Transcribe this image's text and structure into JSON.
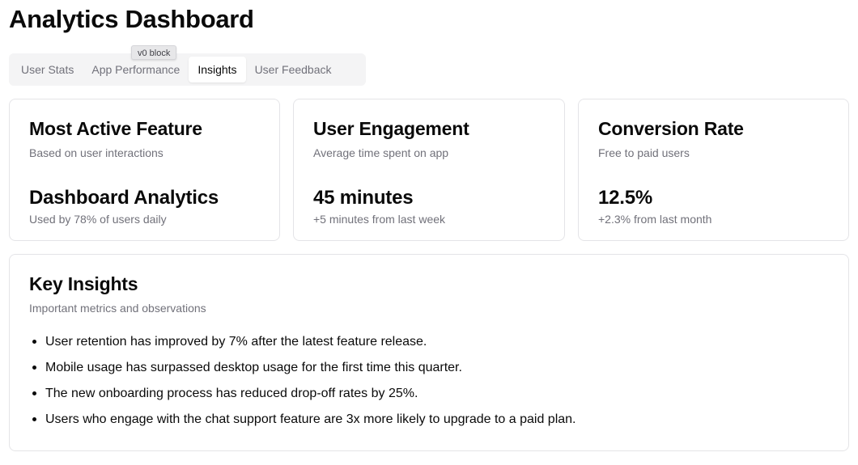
{
  "page": {
    "title": "Analytics Dashboard"
  },
  "tabs": [
    {
      "label": "User Stats",
      "active": false
    },
    {
      "label": "App Performance",
      "active": false
    },
    {
      "label": "Insights",
      "active": true
    },
    {
      "label": "User Feedback",
      "active": false
    }
  ],
  "tooltip": {
    "text": "v0 block"
  },
  "cards": [
    {
      "title": "Most Active Feature",
      "description": "Based on user interactions",
      "value": "Dashboard Analytics",
      "subtext": "Used by 78% of users daily"
    },
    {
      "title": "User Engagement",
      "description": "Average time spent on app",
      "value": "45 minutes",
      "subtext": "+5 minutes from last week"
    },
    {
      "title": "Conversion Rate",
      "description": "Free to paid users",
      "value": "12.5%",
      "subtext": "+2.3% from last month"
    }
  ],
  "insights": {
    "title": "Key Insights",
    "description": "Important metrics and observations",
    "items": [
      "User retention has improved by 7% after the latest feature release.",
      "Mobile usage has surpassed desktop usage for the first time this quarter.",
      "The new onboarding process has reduced drop-off rates by 25%.",
      "Users who engage with the chat support feature are 3x more likely to upgrade to a paid plan."
    ]
  },
  "colors": {
    "text": "#0a0a0a",
    "muted": "#71717a",
    "border": "#e4e4e7",
    "tab_bg": "#f4f4f5"
  }
}
